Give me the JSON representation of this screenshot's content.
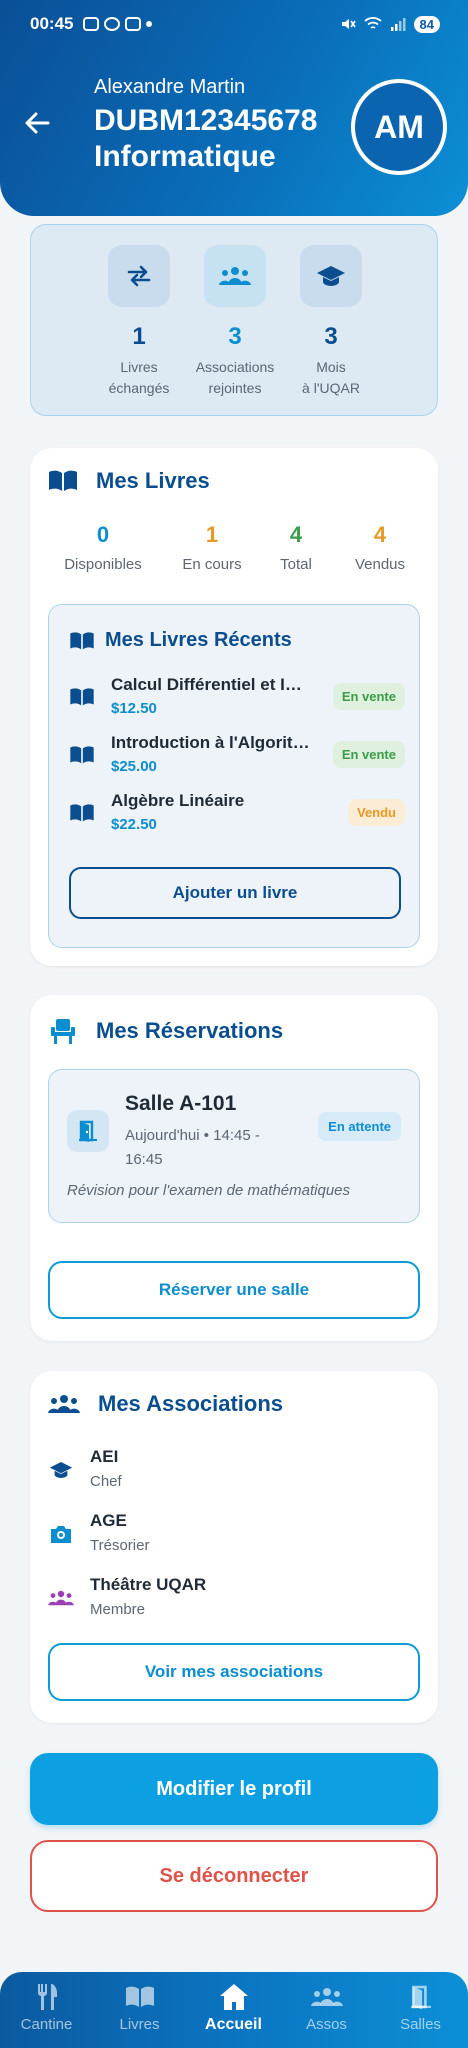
{
  "status_bar": {
    "time": "00:45",
    "battery": "84"
  },
  "header": {
    "back_icon": "arrow-left-icon",
    "name": "Alexandre Martin",
    "code": "DUBM12345678",
    "program": "Informatique",
    "avatar_initials": "AM"
  },
  "stats": [
    {
      "icon": "swap-icon",
      "value": "1",
      "label_1": "Livres",
      "label_2": "échangés",
      "color": "#0b4e8f"
    },
    {
      "icon": "people-icon",
      "value": "3",
      "label_1": "Associations",
      "label_2": "rejointes",
      "color": "#0b8ecf"
    },
    {
      "icon": "graduation-cap-icon",
      "value": "3",
      "label_1": "Mois",
      "label_2": "à l'UQAR",
      "color": "#0b4e8f"
    }
  ],
  "books": {
    "title": "Mes Livres",
    "stats": [
      {
        "value": "0",
        "label": "Disponibles",
        "color": "#0b8ecf"
      },
      {
        "value": "1",
        "label": "En cours",
        "color": "#e69a25"
      },
      {
        "value": "4",
        "label": "Total",
        "color": "#3a9e48"
      },
      {
        "value": "4",
        "label": "Vendus",
        "color": "#e69a25"
      }
    ],
    "recent_title": "Mes Livres Récents",
    "recent": [
      {
        "title": "Calcul Différentiel et Intégral",
        "price": "$12.50",
        "status": "En vente"
      },
      {
        "title": "Introduction à l'Algorithmique",
        "price": "$25.00",
        "status": "En vente"
      },
      {
        "title": "Algèbre Linéaire",
        "price": "$22.50",
        "status": "Vendu"
      }
    ],
    "add_button": "Ajouter un livre"
  },
  "reservations": {
    "title": "Mes Réservations",
    "room": "Salle A-101",
    "time": "Aujourd'hui • 14:45 - 16:45",
    "status": "En attente",
    "note": "Révision pour l'examen de mathématiques",
    "button": "Réserver une salle"
  },
  "associations": {
    "title": "Mes Associations",
    "items": [
      {
        "name": "AEI",
        "role": "Chef",
        "icon": "graduation-cap-icon",
        "color": "#0b4e8f"
      },
      {
        "name": "AGE",
        "role": "Trésorier",
        "icon": "camera-icon",
        "color": "#0b8ecf"
      },
      {
        "name": "Théâtre UQAR",
        "role": "Membre",
        "icon": "people-icon",
        "color": "#9b3fb5"
      }
    ],
    "button": "Voir mes associations"
  },
  "actions": {
    "edit_profile": "Modifier le profil",
    "logout": "Se déconnecter"
  },
  "nav": [
    {
      "label": "Cantine",
      "icon": "utensils-icon",
      "active": false
    },
    {
      "label": "Livres",
      "icon": "book-icon",
      "active": false
    },
    {
      "label": "Accueil",
      "icon": "home-icon",
      "active": true
    },
    {
      "label": "Assos",
      "icon": "people-icon",
      "active": false
    },
    {
      "label": "Salles",
      "icon": "door-icon",
      "active": false
    }
  ]
}
